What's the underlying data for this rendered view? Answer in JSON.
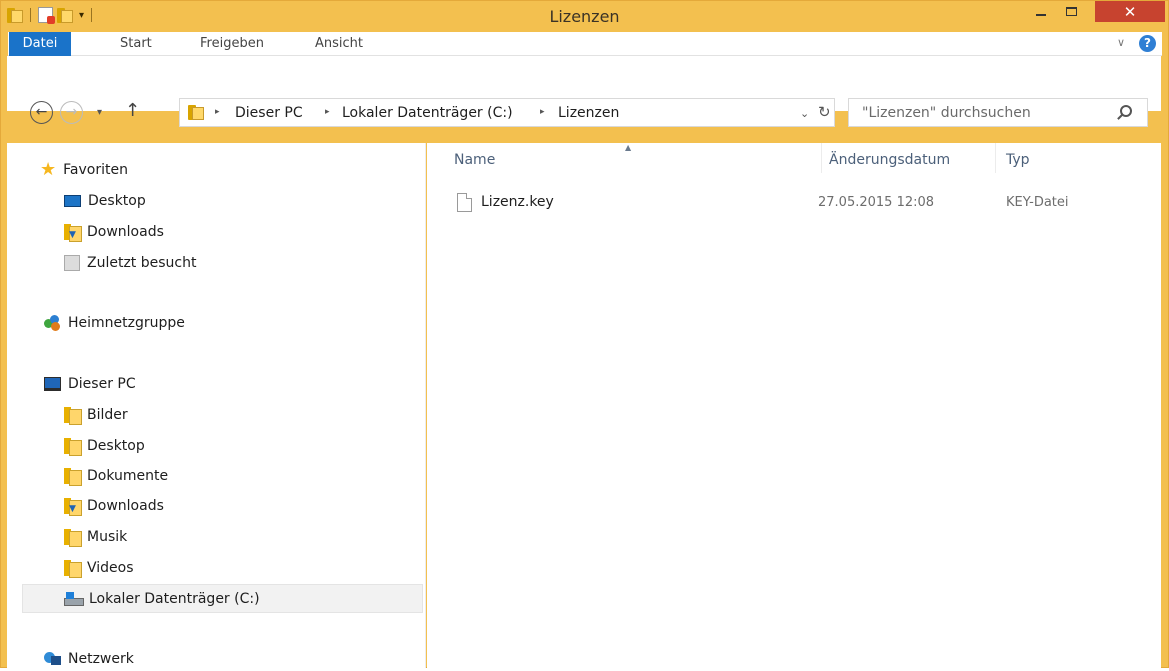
{
  "window": {
    "title": "Lizenzen",
    "close_symbol": "✕",
    "accent_color": "#f3c04f"
  },
  "ribbon": {
    "tabs": [
      "Datei",
      "Start",
      "Freigeben",
      "Ansicht"
    ],
    "active_tab": "Datei",
    "expand_symbol": "∨",
    "help_symbol": "?"
  },
  "address_bar": {
    "breadcrumbs": [
      "Dieser PC",
      "Lokaler Datenträger (C:)",
      "Lizenzen"
    ],
    "separator": "▸"
  },
  "search": {
    "placeholder": "\"Lizenzen\" durchsuchen"
  },
  "navigation": {
    "favorites_label": "Favoriten",
    "favorites": [
      "Desktop",
      "Downloads",
      "Zuletzt besucht"
    ],
    "homegroup_label": "Heimnetzgruppe",
    "this_pc_label": "Dieser PC",
    "this_pc": [
      "Bilder",
      "Desktop",
      "Dokumente",
      "Downloads",
      "Musik",
      "Videos",
      "Lokaler Datenträger (C:)"
    ],
    "selected": "Lokaler Datenträger (C:)",
    "network_label": "Netzwerk"
  },
  "file_list": {
    "columns": [
      "Name",
      "Änderungsdatum",
      "Typ"
    ],
    "rows": [
      {
        "name": "Lizenz.key",
        "date": "27.05.2015 12:08",
        "type": "KEY-Datei"
      }
    ]
  }
}
